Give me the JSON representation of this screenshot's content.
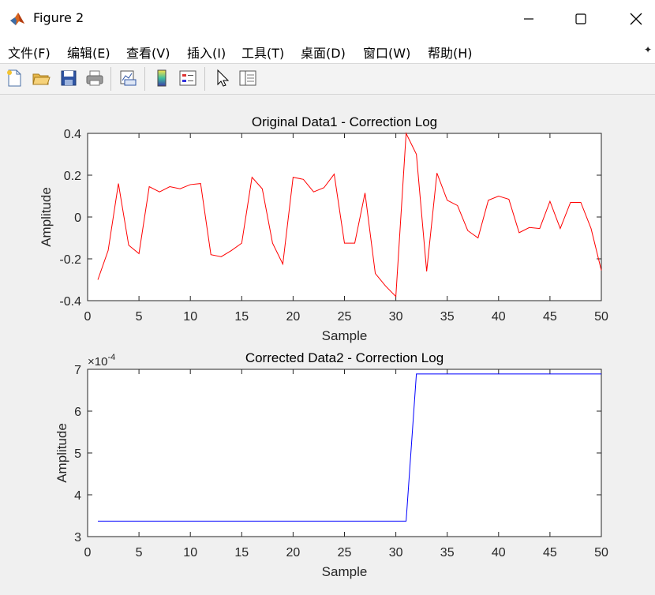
{
  "window": {
    "title": "Figure 2",
    "icon": "matlab-icon",
    "controls": [
      "minimize-icon",
      "maximize-icon",
      "close-icon"
    ]
  },
  "menu": {
    "items": [
      "文件(F)",
      "编辑(E)",
      "查看(V)",
      "插入(I)",
      "工具(T)",
      "桌面(D)",
      "窗口(W)",
      "帮助(H)"
    ]
  },
  "toolbar": {
    "buttons": [
      "new-figure-icon",
      "open-file-icon",
      "save-icon",
      "print-icon",
      "link-plot-icon",
      "colorbar-icon",
      "legend-icon",
      "pointer-icon",
      "property-inspector-icon"
    ]
  },
  "colors": {
    "series1": "#ff0000",
    "series2": "#0000ff"
  },
  "chart_data": [
    {
      "type": "line",
      "title": "Original Data1 - Correction Log",
      "xlabel": "Sample",
      "ylabel": "Amplitude",
      "xlim": [
        0,
        50
      ],
      "ylim": [
        -0.4,
        0.4
      ],
      "xticks": [
        0,
        5,
        10,
        15,
        20,
        25,
        30,
        35,
        40,
        45,
        50
      ],
      "yticks": [
        -0.4,
        -0.2,
        0,
        0.2,
        0.4
      ],
      "ytick_labels": [
        "-0.4",
        "-0.2",
        "0",
        "0.2",
        "0.4"
      ],
      "grid": false,
      "series": [
        {
          "color": "#ff0000",
          "x": [
            1,
            2,
            3,
            4,
            5,
            6,
            7,
            8,
            9,
            10,
            11,
            12,
            13,
            14,
            15,
            16,
            17,
            18,
            19,
            20,
            21,
            22,
            23,
            24,
            25,
            26,
            27,
            28,
            29,
            30,
            31,
            32,
            33,
            34,
            35,
            36,
            37,
            38,
            39,
            40,
            41,
            42,
            43,
            44,
            45,
            46,
            47,
            48,
            49,
            50
          ],
          "values": [
            -0.3,
            -0.16,
            0.16,
            -0.135,
            -0.175,
            0.145,
            0.12,
            0.145,
            0.135,
            0.155,
            0.16,
            -0.18,
            -0.19,
            -0.16,
            -0.125,
            0.19,
            0.135,
            -0.125,
            -0.225,
            0.19,
            0.18,
            0.12,
            0.14,
            0.205,
            -0.125,
            -0.125,
            0.115,
            -0.27,
            -0.33,
            -0.38,
            0.4,
            0.3,
            -0.26,
            0.21,
            0.08,
            0.055,
            -0.065,
            -0.1,
            0.08,
            0.1,
            0.085,
            -0.075,
            -0.05,
            -0.055,
            0.075,
            -0.055,
            0.07,
            0.07,
            -0.055,
            -0.255
          ]
        }
      ]
    },
    {
      "type": "line",
      "title": "Corrected Data2 - Correction Log",
      "xlabel": "Sample",
      "ylabel": "Amplitude",
      "exponent_label": "×10",
      "exponent_power": "-4",
      "xlim": [
        0,
        50
      ],
      "ylim": [
        0.0003,
        0.0007
      ],
      "xticks": [
        0,
        5,
        10,
        15,
        20,
        25,
        30,
        35,
        40,
        45,
        50
      ],
      "yticks": [
        0.0003,
        0.0004,
        0.0005,
        0.0006,
        0.0007
      ],
      "ytick_labels": [
        "3",
        "4",
        "5",
        "6",
        "7"
      ],
      "grid": false,
      "series": [
        {
          "color": "#0000ff",
          "x": [
            1,
            2,
            3,
            4,
            5,
            6,
            7,
            8,
            9,
            10,
            11,
            12,
            13,
            14,
            15,
            16,
            17,
            18,
            19,
            20,
            21,
            22,
            23,
            24,
            25,
            26,
            27,
            28,
            29,
            30,
            31,
            32,
            33,
            34,
            35,
            36,
            37,
            38,
            39,
            40,
            41,
            42,
            43,
            44,
            45,
            46,
            47,
            48,
            49,
            50
          ],
          "values": [
            0.000337,
            0.000337,
            0.000337,
            0.000337,
            0.000337,
            0.000337,
            0.000337,
            0.000337,
            0.000337,
            0.000337,
            0.000337,
            0.000337,
            0.000337,
            0.000337,
            0.000337,
            0.000337,
            0.000337,
            0.000337,
            0.000337,
            0.000337,
            0.000337,
            0.000337,
            0.000337,
            0.000337,
            0.000337,
            0.000337,
            0.000337,
            0.000337,
            0.000337,
            0.000337,
            0.000337,
            0.000689,
            0.000689,
            0.000689,
            0.000689,
            0.000689,
            0.000689,
            0.000689,
            0.000689,
            0.000689,
            0.000689,
            0.000689,
            0.000689,
            0.000689,
            0.000689,
            0.000689,
            0.000689,
            0.000689,
            0.000689,
            0.000689
          ]
        }
      ]
    }
  ]
}
